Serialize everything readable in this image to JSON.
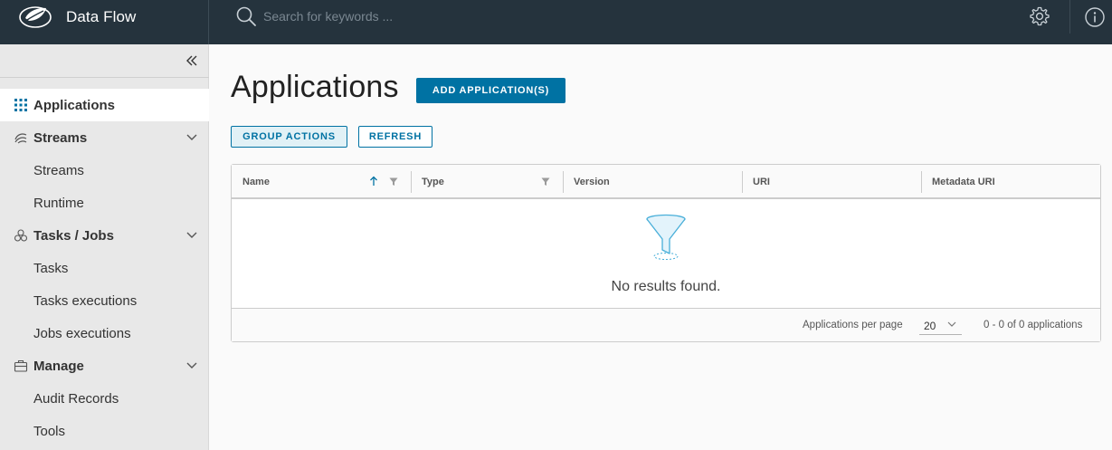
{
  "header": {
    "app_title": "Data Flow",
    "search_placeholder": "Search for keywords ..."
  },
  "sidebar": {
    "items": [
      {
        "label": "Applications",
        "type": "parent",
        "icon": "grid-icon",
        "active": true
      },
      {
        "label": "Streams",
        "type": "parent",
        "icon": "streams-icon",
        "expandable": true
      },
      {
        "label": "Streams",
        "type": "child"
      },
      {
        "label": "Runtime",
        "type": "child"
      },
      {
        "label": "Tasks / Jobs",
        "type": "parent",
        "icon": "tasks-icon",
        "expandable": true
      },
      {
        "label": "Tasks",
        "type": "child"
      },
      {
        "label": "Tasks executions",
        "type": "child"
      },
      {
        "label": "Jobs executions",
        "type": "child"
      },
      {
        "label": "Manage",
        "type": "parent",
        "icon": "briefcase-icon",
        "expandable": true
      },
      {
        "label": "Audit Records",
        "type": "child"
      },
      {
        "label": "Tools",
        "type": "child"
      }
    ]
  },
  "main": {
    "title": "Applications",
    "add_button": "ADD APPLICATION(S)",
    "group_actions_button": "GROUP ACTIONS",
    "refresh_button": "REFRESH",
    "grid": {
      "columns": [
        "Name",
        "Type",
        "Version",
        "URI",
        "Metadata URI"
      ],
      "sorted_column": "Name",
      "sort_direction": "ascending",
      "rows": [],
      "empty_message": "No results found.",
      "footer": {
        "per_page_label": "Applications per page",
        "per_page_value": "20",
        "page_count": "0 - 0 of 0 applications"
      }
    }
  },
  "colors": {
    "header_bg": "#25333d",
    "sidebar_bg": "#e8e8e8",
    "primary": "#0072a3",
    "page_bg": "#fafafa"
  }
}
